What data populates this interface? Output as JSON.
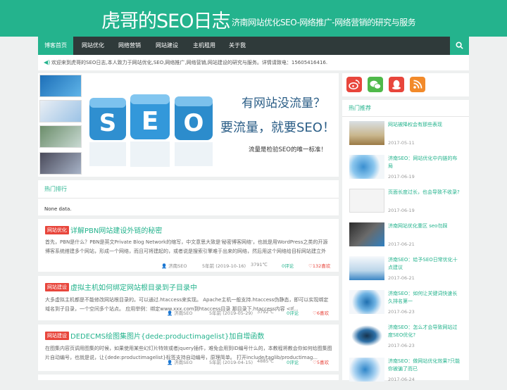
{
  "header": {
    "title": "虎哥的SEO日志",
    "subtitle": "济南网站优化SEO-网络推广-网络营销的研究与服务"
  },
  "nav": {
    "items": [
      "博客首页",
      "网站优化",
      "网络营销",
      "网站建设",
      "主机租用",
      "关于我"
    ]
  },
  "search": {
    "icon": "search-icon"
  },
  "notice": {
    "text": "欢迎来到虎哥的SEO日志,本人致力于网站优化,SEO,网络推广,网络营销,网站建设的研究与服务。详情请致电：15605416416."
  },
  "banner": {
    "line1": "有网站没流量？",
    "line2": "要流量，就要SEO！",
    "line3": "流量是检验SEO的唯一标准！",
    "cubes": [
      "S",
      "E",
      "O"
    ]
  },
  "hot_rank": {
    "heading": "热门排行",
    "empty": "None data."
  },
  "posts": [
    {
      "tag": "网站优化",
      "title": "详解PBN网站建设外链的秘密",
      "excerpt": "首先，PBN是什么？PBN是英文Private Blog Network的缩写，中文意思大致是'秘密博客网络'，也就是用WordPress之类的开源博客系统搭建多个网站，形成一个网络，而且可将建起的，或者说是搜索引擎难于出来的网络，然后用这个网络给目标网站建立外链。 这种...",
      "author": "济南SEO",
      "date": "5年前 (2019-10-16)",
      "temp": "3791℃",
      "comments": "0评论",
      "likes": "132喜欢"
    },
    {
      "tag": "网站建设",
      "title": "虚拟主机如何绑定网站根目录到子目录中",
      "excerpt": "大多虚拟主机都是不能修改网站根目录的。可以通过.htaccess来实现。 Apache主机一般支持.htaccess伪静态，即可以实现绑定域名到子目录，一个空间多个站点。 应用举例：绑定www.xxx.com到htaccess目录 那目录下.htaccess内容 <If...",
      "author": "济南SEO",
      "date": "5年前 (2019-05-29)",
      "temp": "3792℃",
      "comments": "0评论",
      "likes": "6喜欢"
    },
    {
      "tag": "网站建设",
      "title": "DEDECMS绘图集图片{dede:productimagelist}加自增函数",
      "excerpt": "在图集内容页调用图集的时候，如果使用某些幻灯片特效或者jquery插件，难免会用到ID编号什么的，本教程将教会你如何给图集图片自动编号，也就是说，让{dede:productimagelist}标签支持自动编号，原理简单。 打开include/taglib/productimag...",
      "author": "济南SEO",
      "date": "5年前 (2019-04-15)",
      "temp": "4885℃",
      "comments": "0评论",
      "likes": "5喜欢"
    }
  ],
  "social": [
    "weibo-icon",
    "wechat-icon",
    "qq-icon",
    "rss-icon"
  ],
  "sidebar": {
    "heading": "热门推荐",
    "items": [
      {
        "title": "网站被降权会有那些表现",
        "date": "2017-05-11"
      },
      {
        "title": "济南SEO：网站优化中内链的布局",
        "date": "2017-06-19"
      },
      {
        "title": "页面长度过长，也会导致不收录?",
        "date": "2017-06-19"
      },
      {
        "title": "济南网站优化重区 seo勿踩",
        "date": "2017-06-21"
      },
      {
        "title": "济南SEO：给予SEO日常优化十点建议",
        "date": "2017-06-21"
      },
      {
        "title": "济南SEO：如何让关键词快速长久排名第一",
        "date": "2017-06-23"
      },
      {
        "title": "济南SEO：怎么才会导致网站过度SEO优化?",
        "date": "2017-06-23"
      },
      {
        "title": "济南SEO：做网站优化效果?只能你被骗了而已",
        "date": "2017-06-24"
      }
    ]
  },
  "colors": {
    "accent": "#24b38d",
    "nav": "#2f3a3a",
    "tag": "#e8463c"
  }
}
